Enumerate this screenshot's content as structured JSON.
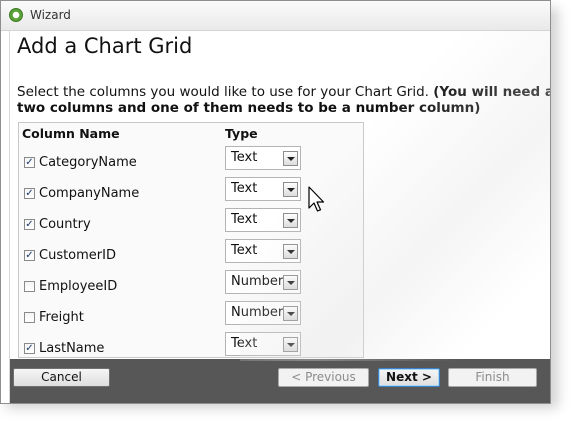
{
  "window": {
    "title": "Wizard",
    "app_icon": "wizard-app-icon"
  },
  "page": {
    "title": "Add a Chart Grid",
    "instructions_line1": "Select the columns you would like to use for your Chart Grid. ",
    "instructions_bold1": "(You will need at",
    "instructions_line2_bold": "two columns and one of them needs to be a number column)"
  },
  "grid": {
    "headers": {
      "column_name": "Column Name",
      "type": "Type"
    },
    "rows": [
      {
        "name": "CategoryName",
        "checked": true,
        "type": "Text"
      },
      {
        "name": "CompanyName",
        "checked": true,
        "type": "Text"
      },
      {
        "name": "Country",
        "checked": true,
        "type": "Text"
      },
      {
        "name": "CustomerID",
        "checked": true,
        "type": "Text"
      },
      {
        "name": "EmployeeID",
        "checked": false,
        "type": "Number"
      },
      {
        "name": "Freight",
        "checked": false,
        "type": "Number"
      },
      {
        "name": "LastName",
        "checked": true,
        "type": "Text"
      }
    ]
  },
  "footer": {
    "cancel_label": "Cancel",
    "previous_label": "< Previous",
    "next_label": "Next >",
    "finish_label": "Finish"
  }
}
